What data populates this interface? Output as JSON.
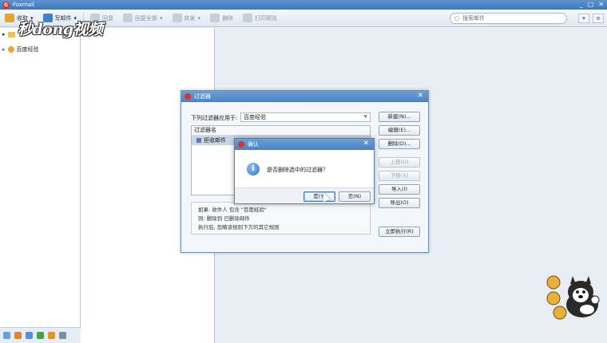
{
  "app": {
    "title": "Foxmail"
  },
  "window_controls": [
    "_",
    "▢",
    "✕"
  ],
  "watermark": "秒dong视频",
  "toolbar": {
    "receive": "收取",
    "compose": "写邮件",
    "reply": "回复",
    "reply_all": "回复全部",
    "forward": "转发",
    "delete": "删除",
    "print_preview": "打印预览",
    "search_placeholder": "搜索邮件"
  },
  "folders": {
    "account": "百度经验"
  },
  "filter_dialog": {
    "title": "过滤器",
    "apply_label": "下列过滤器应用于:",
    "apply_value": "百度经验",
    "list_header": "过滤器名",
    "list_items": [
      "拒收邮件"
    ],
    "description": [
      "如果: 收件人 包含 \"百度经验\"",
      "则: 删除到 已删除邮件",
      "执行后, 忽略该规则下方的其它规则"
    ],
    "buttons": {
      "new": "新建(N)...",
      "edit": "编辑(E)...",
      "delete": "删除(D)...",
      "move_up": "上移(U)",
      "move_down": "下移(X)",
      "import": "导入(I)",
      "export": "导出(O)",
      "run_now": "立即执行(R)"
    }
  },
  "confirm_dialog": {
    "title": "确认",
    "message": "是否删除选中的过滤器？",
    "yes": "是(Y)",
    "no": "否(N)"
  },
  "colors": {
    "titlebar": "#4a82c4",
    "brand": "#d9342b"
  }
}
